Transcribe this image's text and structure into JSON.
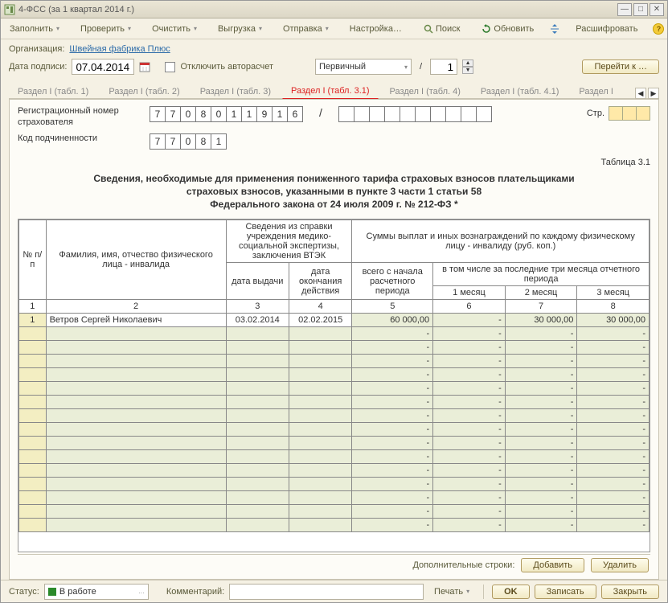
{
  "window": {
    "title": "4-ФСС (за 1 квартал 2014 г.)"
  },
  "toolbar": {
    "fill": "Заполнить",
    "check": "Проверить",
    "clear": "Очистить",
    "export": "Выгрузка",
    "send": "Отправка",
    "settings": "Настройка…",
    "search": "Поиск",
    "refresh": "Обновить",
    "decode": "Расшифровать"
  },
  "org": {
    "label": "Организация:",
    "value": "Швейная фабрика Плюс"
  },
  "line2": {
    "date_label": "Дата подписи:",
    "date_value": "07.04.2014",
    "autorecalc": "Отключить авторасчет",
    "doc_type": "Первичный",
    "corr_num": "1",
    "goto": "Перейти к …"
  },
  "tabs": [
    "Раздел I (табл. 1)",
    "Раздел I (табл. 2)",
    "Раздел I (табл. 3)",
    "Раздел I (табл. 3.1)",
    "Раздел I (табл. 4)",
    "Раздел I (табл. 4.1)",
    "Раздел I"
  ],
  "active_tab": 3,
  "form": {
    "reg_label": "Регистрационный номер страхователя",
    "reg_cells": [
      "7",
      "7",
      "0",
      "8",
      "0",
      "1",
      "1",
      "9",
      "1",
      "6"
    ],
    "sub_label": "Код подчиненности",
    "sub_cells": [
      "7",
      "7",
      "0",
      "8",
      "1"
    ],
    "page_label": "Стр.",
    "table_label": "Таблица 3.1",
    "heading_l1": "Сведения, необходимые для применения пониженного тарифа страховых взносов плательщиками",
    "heading_l2": "страховых взносов, указанными в пункте 3 части 1 статьи 58",
    "heading_l3": "Федерального закона от 24 июля 2009 г. № 212-ФЗ *"
  },
  "grid": {
    "h_num": "№ п/п",
    "h_fio": "Фамилия, имя, отчество физического лица - инвалида",
    "h_cert": "Сведения из справки учреждения медико-социальной экспертизы, заключения ВТЭК",
    "h_sums": "Суммы выплат и иных вознаграждений по каждому физическому лицу - инвалиду (руб. коп.)",
    "h_date_issue": "дата выдачи",
    "h_date_end": "дата окончания действия",
    "h_total": "всего с начала расчетного периода",
    "h_last3": "в том числе за последние три месяца отчетного периода",
    "h_m1": "1 месяц",
    "h_m2": "2 месяц",
    "h_m3": "3 месяц",
    "colnums": [
      "1",
      "2",
      "3",
      "4",
      "5",
      "6",
      "7",
      "8"
    ],
    "rows": [
      {
        "n": "1",
        "fio": "Ветров Сергей Николаевич",
        "d1": "03.02.2014",
        "d2": "02.02.2015",
        "total": "60 000,00",
        "m1": "-",
        "m2": "30 000,00",
        "m3": "30 000,00"
      }
    ],
    "empty_rows": 15
  },
  "extra": {
    "label": "Дополнительные строки:",
    "add": "Добавить",
    "del": "Удалить"
  },
  "footer": {
    "status_label": "Статус:",
    "status_value": "В работе",
    "comment_label": "Комментарий:",
    "print": "Печать",
    "ok": "OK",
    "save": "Записать",
    "close": "Закрыть"
  }
}
